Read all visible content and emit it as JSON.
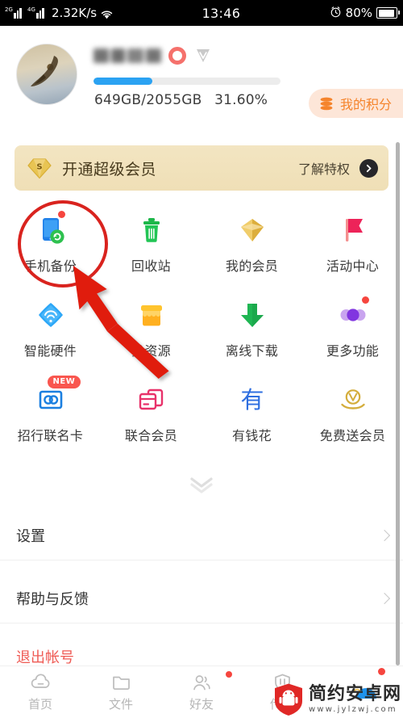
{
  "statusbar": {
    "net_label_2g": "2G",
    "net_label_4g": "4G",
    "net_speed": "2.32K/s",
    "wifi_icon": "wifi-icon",
    "time": "13:46",
    "alarm_icon": "alarm-clock-icon",
    "battery_percent": "80%",
    "battery_icon": "battery-icon"
  },
  "profile": {
    "avatar_icon": "user-avatar",
    "username": "",
    "vip_badge_icon": "vip-diamond-badge",
    "storage_text": "649GB/2055GB",
    "storage_percent_text": "31.60%",
    "storage_percent_value": 31.6,
    "progress_color": "#2ba2f2",
    "points_button": {
      "label": "我的积分",
      "icon": "coin-stack-icon",
      "bg_color": "#fde6d8",
      "text_color": "#f5842c"
    }
  },
  "svip_banner": {
    "icon": "svip-diamond-icon",
    "title": "开通超级会员",
    "link_label": "了解特权",
    "arrow_icon": "chevron-right-circle-icon",
    "bg_color": "#f1e2bb"
  },
  "grid": {
    "rows": [
      [
        {
          "label": "手机备份",
          "icon": "phone-backup-icon",
          "badge": "dot"
        },
        {
          "label": "回收站",
          "icon": "trash-bin-icon",
          "badge": ""
        },
        {
          "label": "我的会员",
          "icon": "vip-diamond-icon",
          "badge": ""
        },
        {
          "label": "活动中心",
          "icon": "flag-icon",
          "badge": ""
        }
      ],
      [
        {
          "label": "智能硬件",
          "icon": "smart-hardware-icon",
          "badge": ""
        },
        {
          "label": "找资源",
          "icon": "resource-box-icon",
          "badge": ""
        },
        {
          "label": "离线下载",
          "icon": "download-arrow-icon",
          "badge": ""
        },
        {
          "label": "更多功能",
          "icon": "more-dots-icon",
          "badge": "dot"
        }
      ],
      [
        {
          "label": "招行联名卡",
          "icon": "cmb-card-icon",
          "badge": "NEW"
        },
        {
          "label": "联合会员",
          "icon": "union-member-card-icon",
          "badge": ""
        },
        {
          "label": "有钱花",
          "icon": "youqianhua-icon",
          "badge": ""
        },
        {
          "label": "免费送会员",
          "icon": "gift-vip-icon",
          "badge": ""
        }
      ]
    ],
    "expand_icon": "chevron-double-down-icon"
  },
  "list": {
    "items": [
      {
        "label": "设置",
        "chevron": "chevron-right-icon"
      },
      {
        "label": "帮助与反馈",
        "chevron": "chevron-right-icon"
      }
    ],
    "logout_label": "退出帐号",
    "logout_color": "#ef5b55"
  },
  "tabbar": {
    "tabs": [
      {
        "label": "首页",
        "icon": "cloud-icon",
        "badge": ""
      },
      {
        "label": "文件",
        "icon": "folder-icon",
        "badge": ""
      },
      {
        "label": "好友",
        "icon": "friends-icon",
        "badge": "dot"
      },
      {
        "label": "传输",
        "icon": "transfer-shield-icon",
        "badge": ""
      },
      {
        "label": "",
        "icon": "profile-arc-icon",
        "badge": "dot"
      }
    ]
  },
  "annotations": {
    "highlight_circle": "red-annotation-circle",
    "pointer_arrow": "red-annotation-arrow",
    "target": "手机备份"
  },
  "watermark": {
    "shield_icon": "android-shield-logo",
    "site_name": "简约安卓网",
    "site_url": "www.jylzwj.com"
  }
}
